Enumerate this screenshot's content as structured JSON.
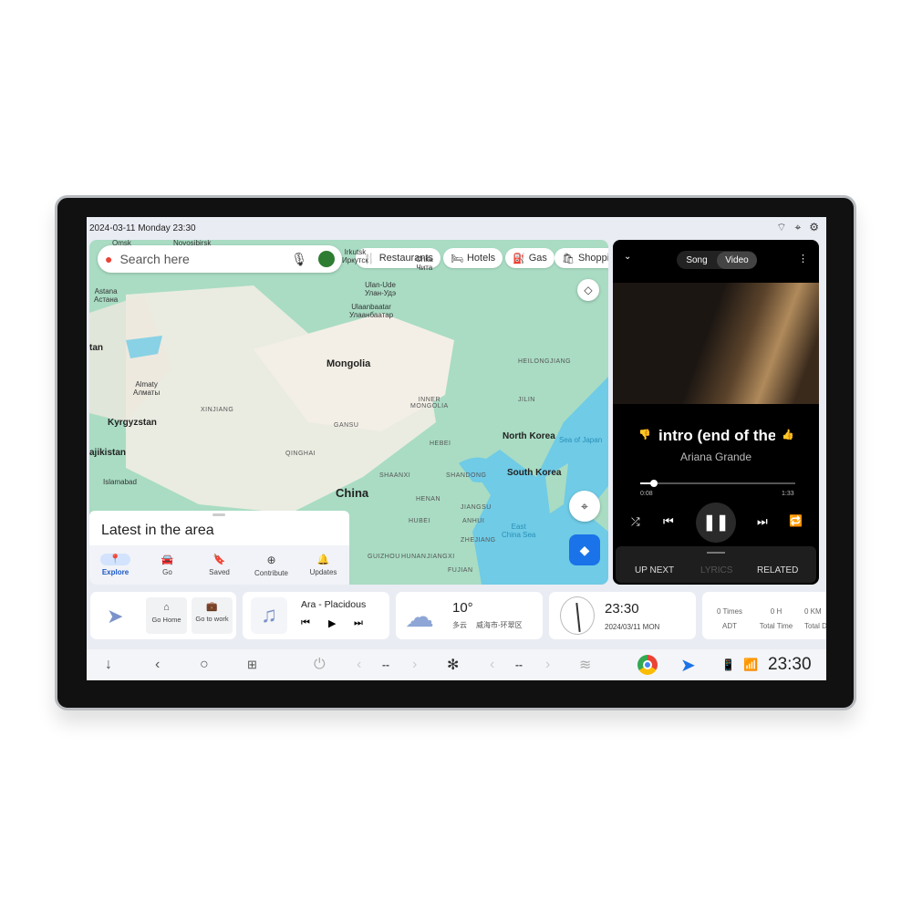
{
  "status_bar": {
    "datetime": "2024-03-11 Monday 23:30"
  },
  "map": {
    "search_placeholder": "Search here",
    "chips": [
      "Restaurants",
      "Hotels",
      "Gas",
      "Shoppin"
    ],
    "labels": {
      "countries": [
        "Mongolia",
        "China",
        "North Korea",
        "South Korea",
        "Kyrgyzstan",
        "ajikistan",
        "tan"
      ],
      "cities": [
        "Omsk",
        "Novosibirsk",
        "Astana\nАстана",
        "Almaty\nАлматы",
        "Islamabad",
        "Irkutsk\nИркутск",
        "Chita\nЧита",
        "Ulan-Ude\nУлан-Удэ",
        "Ulaanbaatar\nУлаанбаатар"
      ],
      "regions": [
        "XINJIANG",
        "QINGHAI",
        "GANSU",
        "INNER\nMONGOLIA",
        "HEILONGJIANG",
        "JILIN",
        "HEBEI",
        "SHAANXI",
        "SHANDONG",
        "HENAN",
        "JIANGSU",
        "HUBEI",
        "ANHUI",
        "ZHEJIANG",
        "GUIZHOU",
        "HUNAN",
        "JIANGXI",
        "FUJIAN"
      ],
      "seas": [
        "Sea of Japan",
        "East\nChina Sea"
      ]
    },
    "sheet_title": "Latest in the area",
    "nav": [
      {
        "label": "Explore",
        "icon": "pin-icon",
        "active": true
      },
      {
        "label": "Go",
        "icon": "car-icon"
      },
      {
        "label": "Saved",
        "icon": "bookmark-icon"
      },
      {
        "label": "Contribute",
        "icon": "plus-circle-icon"
      },
      {
        "label": "Updates",
        "icon": "bell-icon"
      }
    ]
  },
  "player": {
    "tabs": [
      "Song",
      "Video"
    ],
    "active_tab": "Video",
    "title": "intro (end of the",
    "artist": "Ariana Grande",
    "elapsed": "0:08",
    "duration": "1:33",
    "progress": 0.086,
    "bottom_tabs": [
      "UP NEXT",
      "LYRICS",
      "RELATED"
    ]
  },
  "widgets": {
    "nav": {
      "home": "Go Home",
      "work": "Go to work"
    },
    "music": {
      "track": "Ara - Placidous"
    },
    "weather": {
      "temp": "10°",
      "condition": "多云",
      "location": "威海市-环翠区"
    },
    "clock": {
      "time": "23:30",
      "date": "2024/03/11 MON"
    },
    "stats": [
      {
        "value": "0 Times",
        "label": "ADT"
      },
      {
        "value": "0 H",
        "label": "Total Time"
      },
      {
        "value": "0 KM",
        "label": "Total Distance"
      }
    ]
  },
  "dock": {
    "temp_left": "--",
    "temp_right": "--",
    "time": "23:30"
  },
  "colors": {
    "accent": "#1a73e8",
    "map_land": "#a9dcc3",
    "sea": "#6fcbe6"
  }
}
